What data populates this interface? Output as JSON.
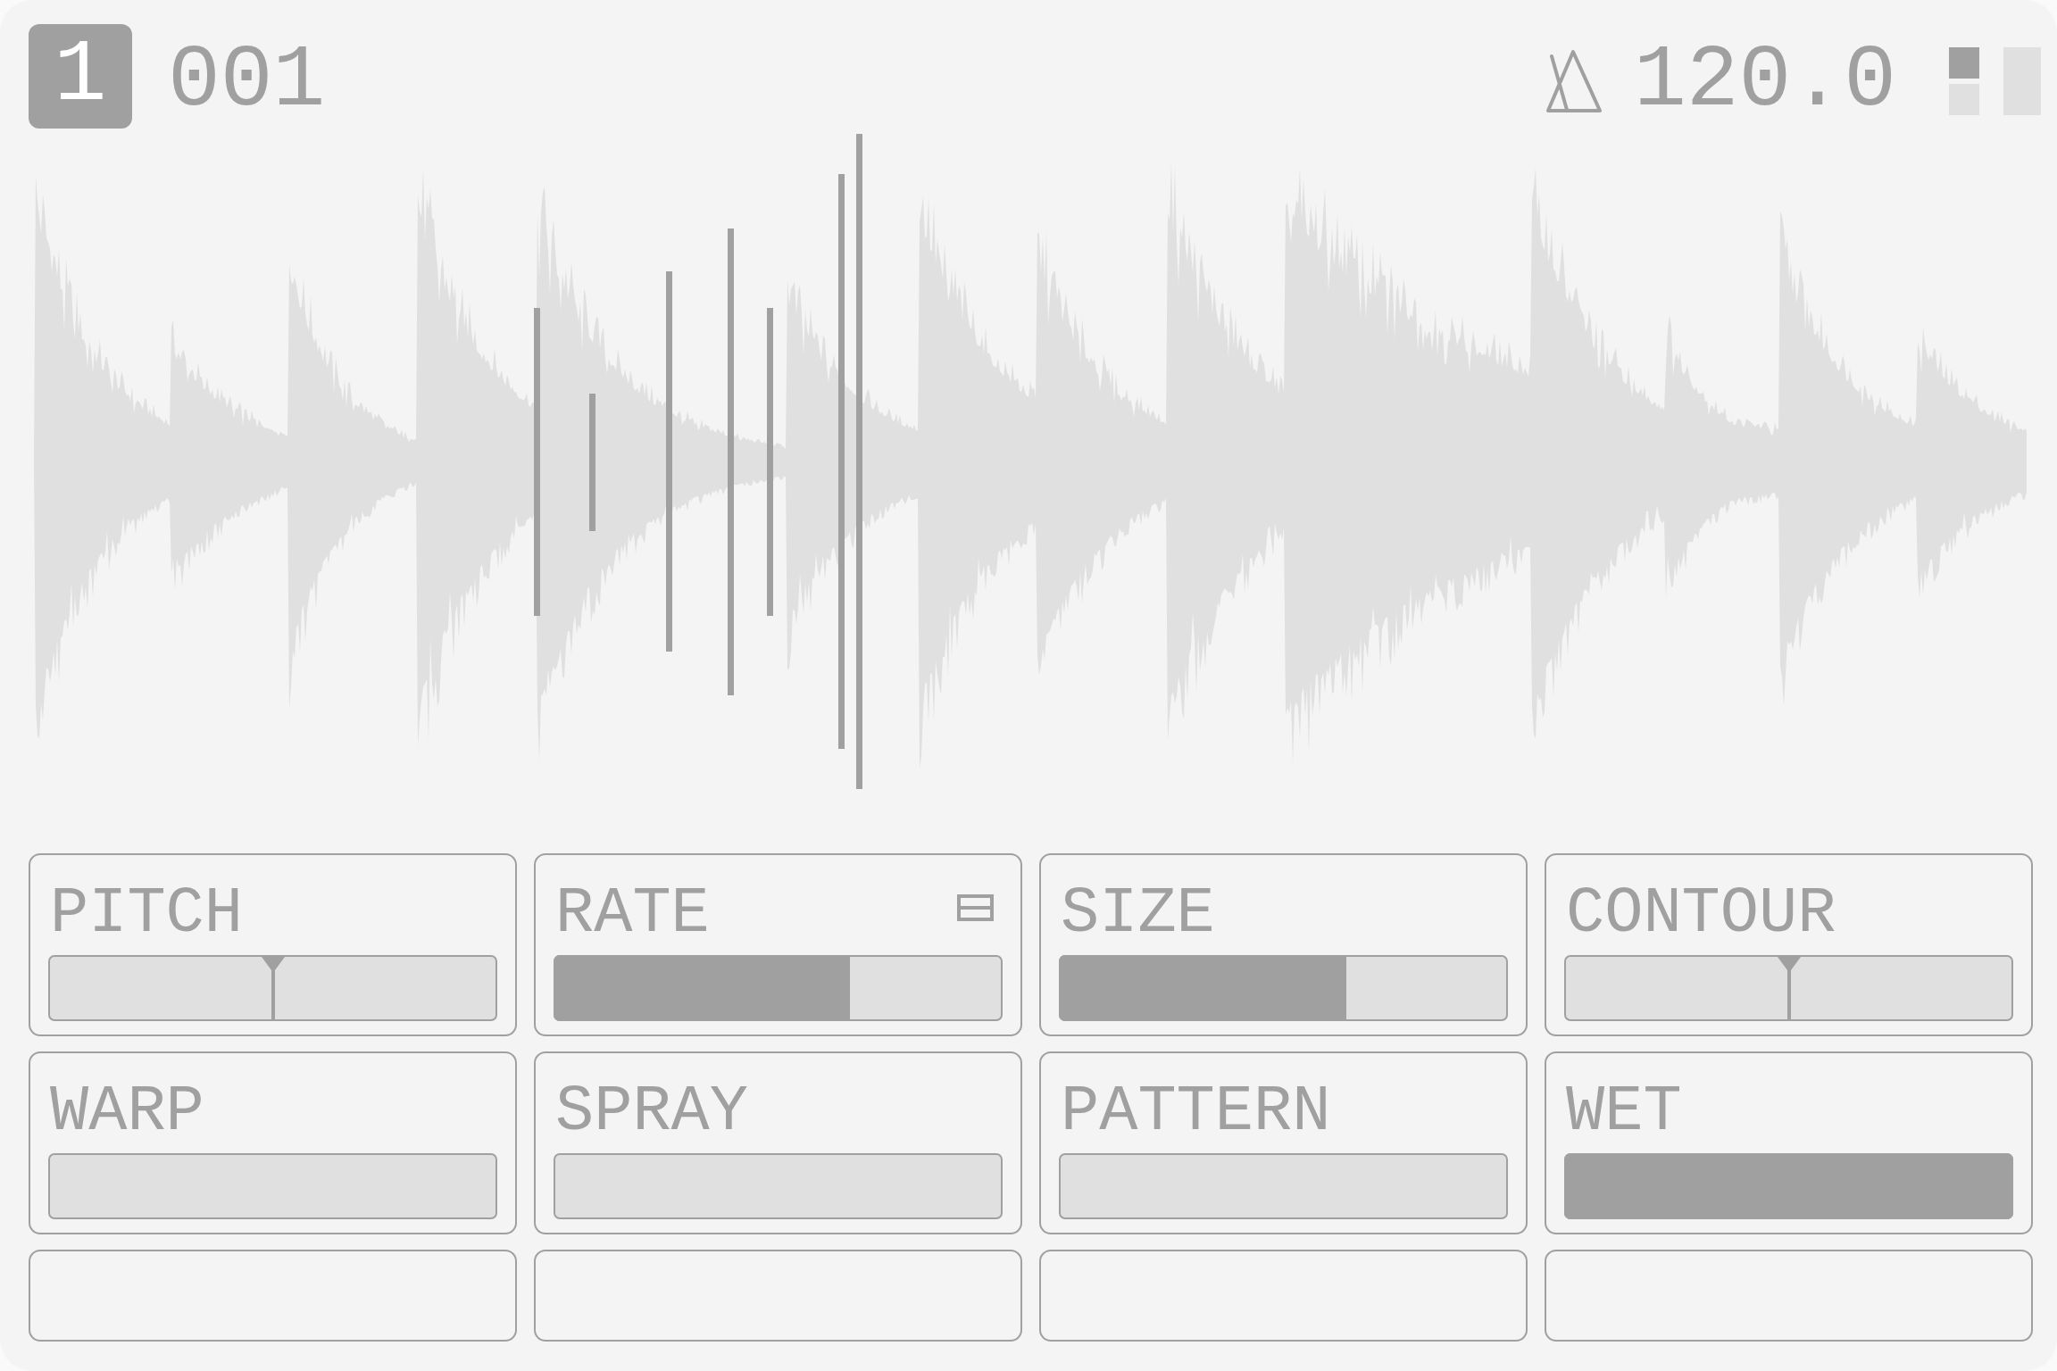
{
  "header": {
    "badge": "1",
    "counter": "001",
    "tempo": "120.0"
  },
  "params": [
    {
      "kind": "bipolar",
      "label": "PITCH",
      "level": 0.5,
      "indicator": false
    },
    {
      "kind": "unipolar",
      "label": "RATE",
      "level": 0.66,
      "indicator": true
    },
    {
      "kind": "unipolar",
      "label": "SIZE",
      "level": 0.64,
      "indicator": false
    },
    {
      "kind": "bipolar",
      "label": "CONTOUR",
      "level": 0.5,
      "indicator": false
    },
    {
      "kind": "unipolar",
      "label": "WARP",
      "level": 0,
      "indicator": false
    },
    {
      "kind": "unipolar",
      "label": "SPRAY",
      "level": 0,
      "indicator": false
    },
    {
      "kind": "unipolar",
      "label": "PATTERN",
      "level": 0,
      "indicator": false
    },
    {
      "kind": "unipolar",
      "label": "WET",
      "level": 1,
      "indicator": false
    },
    {
      "kind": "empty"
    },
    {
      "kind": "empty"
    },
    {
      "kind": "empty"
    },
    {
      "kind": "empty"
    }
  ]
}
